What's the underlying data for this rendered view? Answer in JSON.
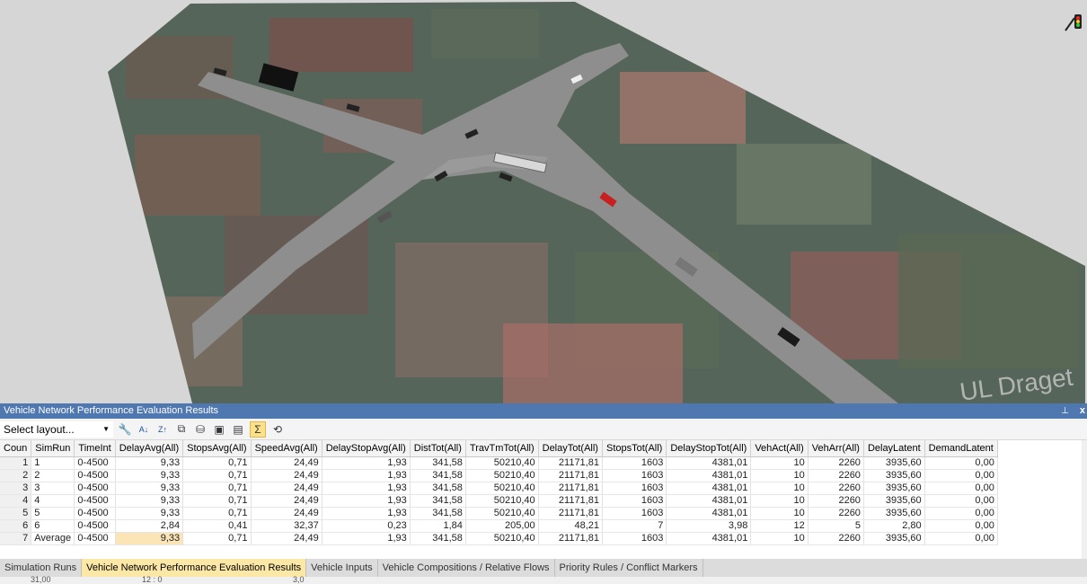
{
  "panel": {
    "title": "Vehicle Network Performance Evaluation Results",
    "pin_icon": "pin-icon",
    "close_label": "x"
  },
  "toolbar": {
    "layout_select": {
      "value": "Select layout...",
      "icon": "chevron-down-icon"
    },
    "buttons": [
      "wrench-icon",
      "sort-ascending-icon",
      "sort-descending-icon",
      "copy-icon",
      "database-icon",
      "save-icon",
      "save-as-icon",
      "sum-icon",
      "history-icon"
    ],
    "sum_label": "Σ",
    "sum_selected": true
  },
  "table": {
    "headers": [
      "Coun",
      "SimRun",
      "TimeInt",
      "DelayAvg(All)",
      "StopsAvg(All)",
      "SpeedAvg(All)",
      "DelayStopAvg(All)",
      "DistTot(All)",
      "TravTmTot(All)",
      "DelayTot(All)",
      "StopsTot(All)",
      "DelayStopTot(All)",
      "VehAct(All)",
      "VehArr(All)",
      "DelayLatent",
      "DemandLatent"
    ],
    "rows": [
      [
        "1",
        "1",
        "0-4500",
        "9,33",
        "0,71",
        "24,49",
        "1,93",
        "341,58",
        "50210,40",
        "21171,81",
        "1603",
        "4381,01",
        "10",
        "2260",
        "3935,60",
        "0,00"
      ],
      [
        "2",
        "2",
        "0-4500",
        "9,33",
        "0,71",
        "24,49",
        "1,93",
        "341,58",
        "50210,40",
        "21171,81",
        "1603",
        "4381,01",
        "10",
        "2260",
        "3935,60",
        "0,00"
      ],
      [
        "3",
        "3",
        "0-4500",
        "9,33",
        "0,71",
        "24,49",
        "1,93",
        "341,58",
        "50210,40",
        "21171,81",
        "1603",
        "4381,01",
        "10",
        "2260",
        "3935,60",
        "0,00"
      ],
      [
        "4",
        "4",
        "0-4500",
        "9,33",
        "0,71",
        "24,49",
        "1,93",
        "341,58",
        "50210,40",
        "21171,81",
        "1603",
        "4381,01",
        "10",
        "2260",
        "3935,60",
        "0,00"
      ],
      [
        "5",
        "5",
        "0-4500",
        "9,33",
        "0,71",
        "24,49",
        "1,93",
        "341,58",
        "50210,40",
        "21171,81",
        "1603",
        "4381,01",
        "10",
        "2260",
        "3935,60",
        "0,00"
      ],
      [
        "6",
        "6",
        "0-4500",
        "2,84",
        "0,41",
        "32,37",
        "0,23",
        "1,84",
        "205,00",
        "48,21",
        "7",
        "3,98",
        "12",
        "5",
        "2,80",
        "0,00"
      ],
      [
        "7",
        "Average",
        "0-4500",
        "9,33",
        "0,71",
        "24,49",
        "1,93",
        "341,58",
        "50210,40",
        "21171,81",
        "1603",
        "4381,01",
        "10",
        "2260",
        "3935,60",
        "0,00"
      ]
    ],
    "highlight_cell": {
      "row": 6,
      "col": 3
    }
  },
  "tabs": [
    {
      "label": "Simulation Runs",
      "active": false
    },
    {
      "label": "Vehicle Network Performance Evaluation Results",
      "active": true
    },
    {
      "label": "Vehicle Inputs",
      "active": false
    },
    {
      "label": "Vehicle Compositions / Relative Flows",
      "active": false
    },
    {
      "label": "Priority Rules / Conflict Markers",
      "active": false
    }
  ],
  "status": {
    "left": "31,00",
    "mid": "12 : 0",
    "right": "3,0"
  },
  "viewport": {
    "signal_icon": "traffic-signal-icon",
    "map_label": "UL Draget"
  },
  "colors": {
    "title_bar": "#4f78b0",
    "active_tab": "#fbe7a6",
    "highlight": "#fbe5b6"
  }
}
